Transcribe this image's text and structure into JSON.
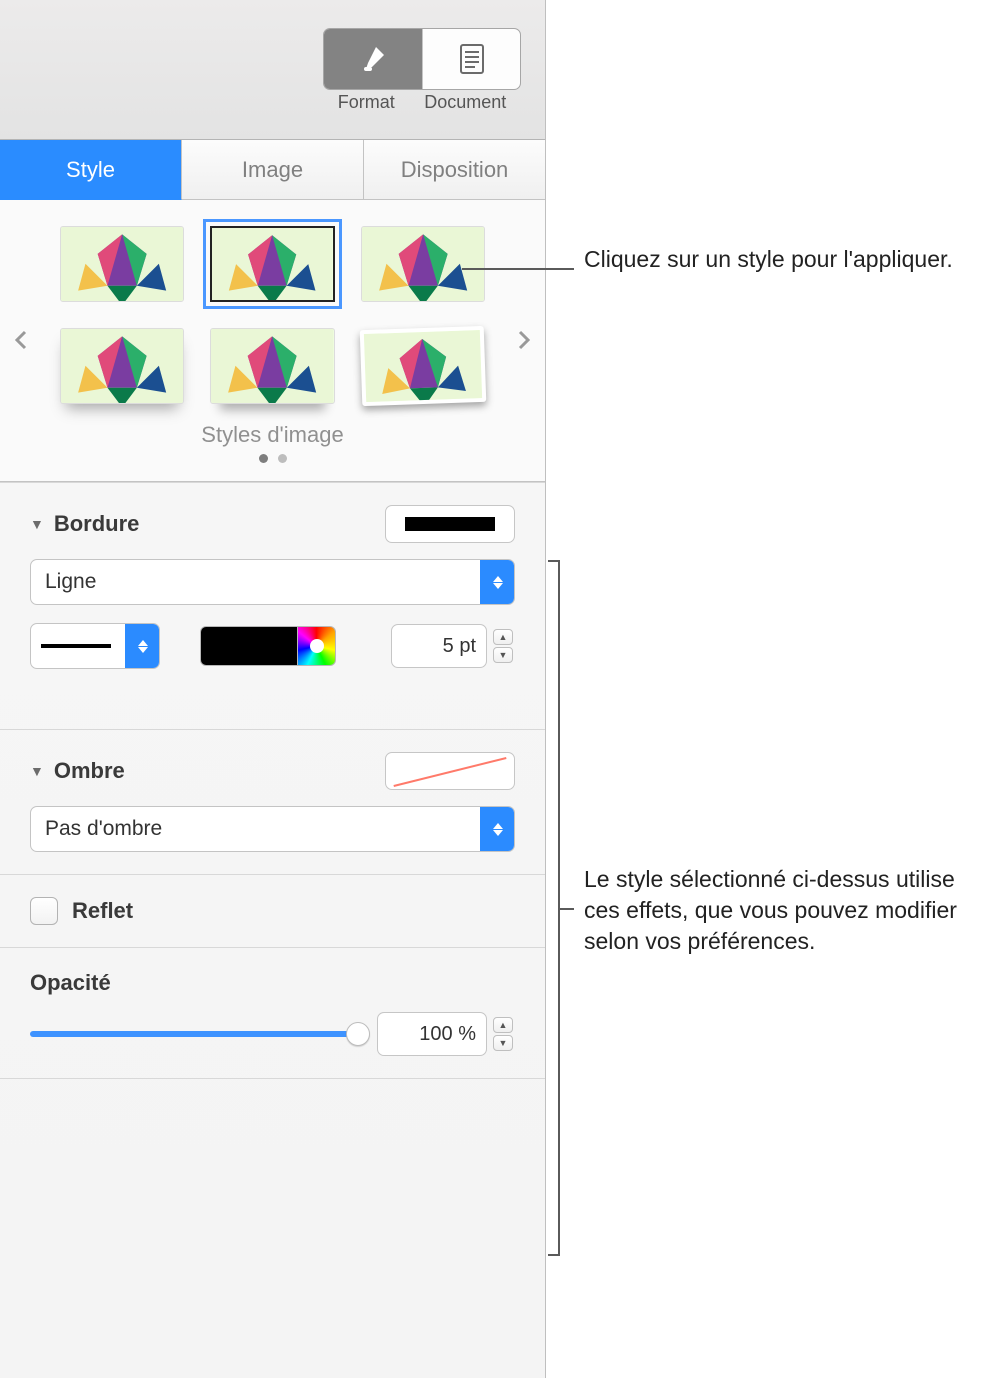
{
  "toolbar": {
    "format_label": "Format",
    "document_label": "Document"
  },
  "tabs": {
    "style": "Style",
    "image": "Image",
    "layout": "Disposition"
  },
  "styles": {
    "section_label": "Styles d'image"
  },
  "border": {
    "title": "Bordure",
    "type_value": "Ligne",
    "thickness_value": "5 pt"
  },
  "shadow": {
    "title": "Ombre",
    "value": "Pas d'ombre"
  },
  "reflection": {
    "label": "Reflet"
  },
  "opacity": {
    "title": "Opacité",
    "value": "100 %"
  },
  "callouts": {
    "apply_style": "Cliquez sur un style pour l'appliquer.",
    "effects": "Le style sélectionné ci-dessus utilise ces effets, que vous pouvez modifier selon vos préférences."
  }
}
